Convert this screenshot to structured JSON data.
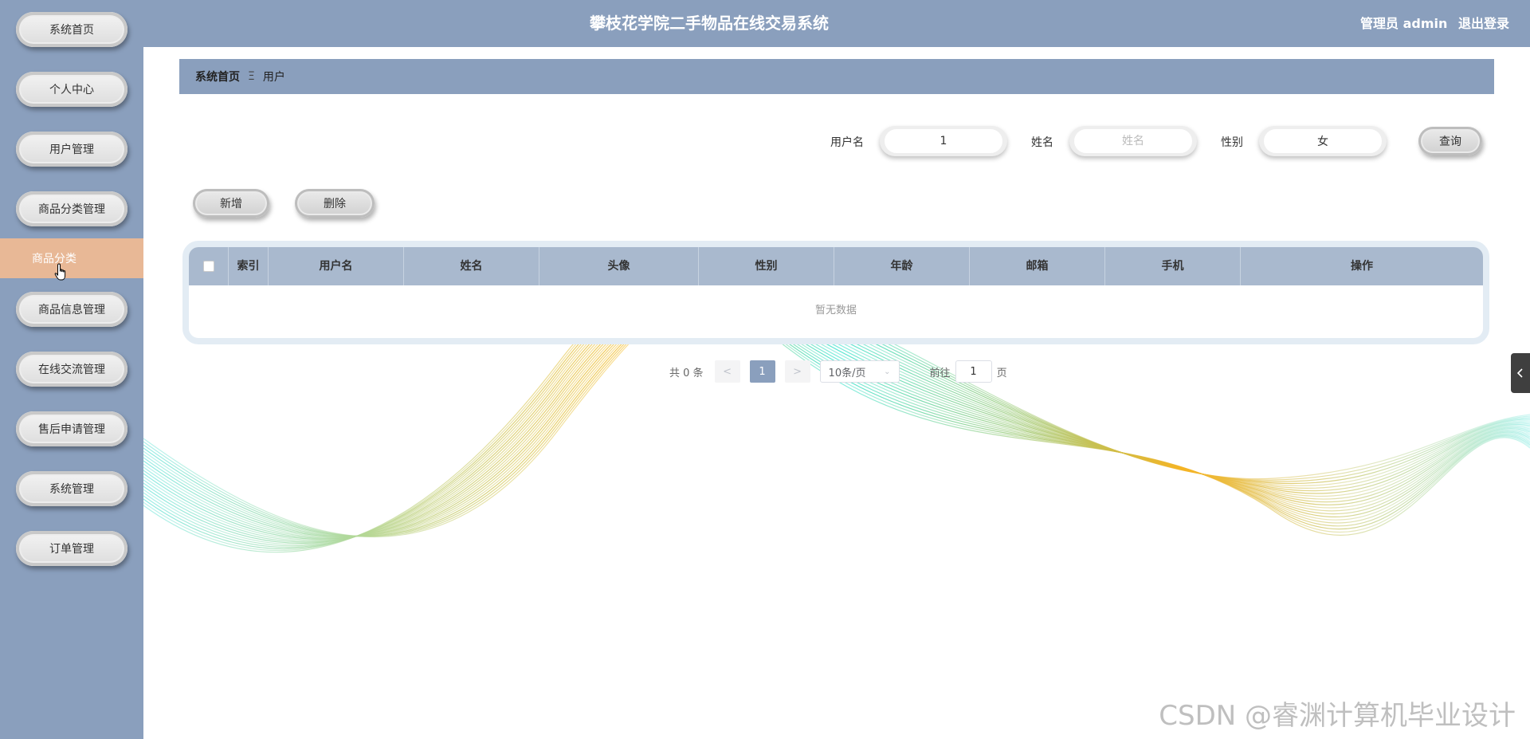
{
  "header": {
    "title": "攀枝花学院二手物品在线交易系统",
    "user_label": "管理员 admin",
    "logout_label": "退出登录"
  },
  "sidebar": {
    "items": [
      {
        "label": "系统首页"
      },
      {
        "label": "个人中心"
      },
      {
        "label": "用户管理"
      },
      {
        "label": "商品分类管理"
      },
      {
        "label": "商品分类",
        "active": true
      },
      {
        "label": "商品信息管理"
      },
      {
        "label": "在线交流管理"
      },
      {
        "label": "售后申请管理"
      },
      {
        "label": "系统管理"
      },
      {
        "label": "订单管理"
      }
    ]
  },
  "breadcrumb": {
    "home": "系统首页",
    "separator": "Ξ",
    "current": "用户"
  },
  "search": {
    "username_label": "用户名",
    "username_value": "1",
    "name_label": "姓名",
    "name_placeholder": "姓名",
    "gender_label": "性别",
    "gender_value": "女",
    "query_label": "查询"
  },
  "actions": {
    "add_label": "新增",
    "delete_label": "删除"
  },
  "table": {
    "columns": [
      "索引",
      "用户名",
      "姓名",
      "头像",
      "性别",
      "年龄",
      "邮箱",
      "手机",
      "操作"
    ],
    "empty_text": "暂无数据"
  },
  "pagination": {
    "total_label": "共 0 条",
    "prev": "<",
    "current_page": "1",
    "next": ">",
    "page_size": "10条/页",
    "goto_label": "前往",
    "goto_value": "1",
    "page_suffix": "页"
  },
  "watermark": "CSDN @睿渊计算机毕业设计",
  "colors": {
    "primary": "#8a9fbd",
    "active_nav": "#e8b896",
    "table_header": "#a9b9ce",
    "wave_teal": "#3ee6d0",
    "wave_orange": "#f5b323"
  }
}
